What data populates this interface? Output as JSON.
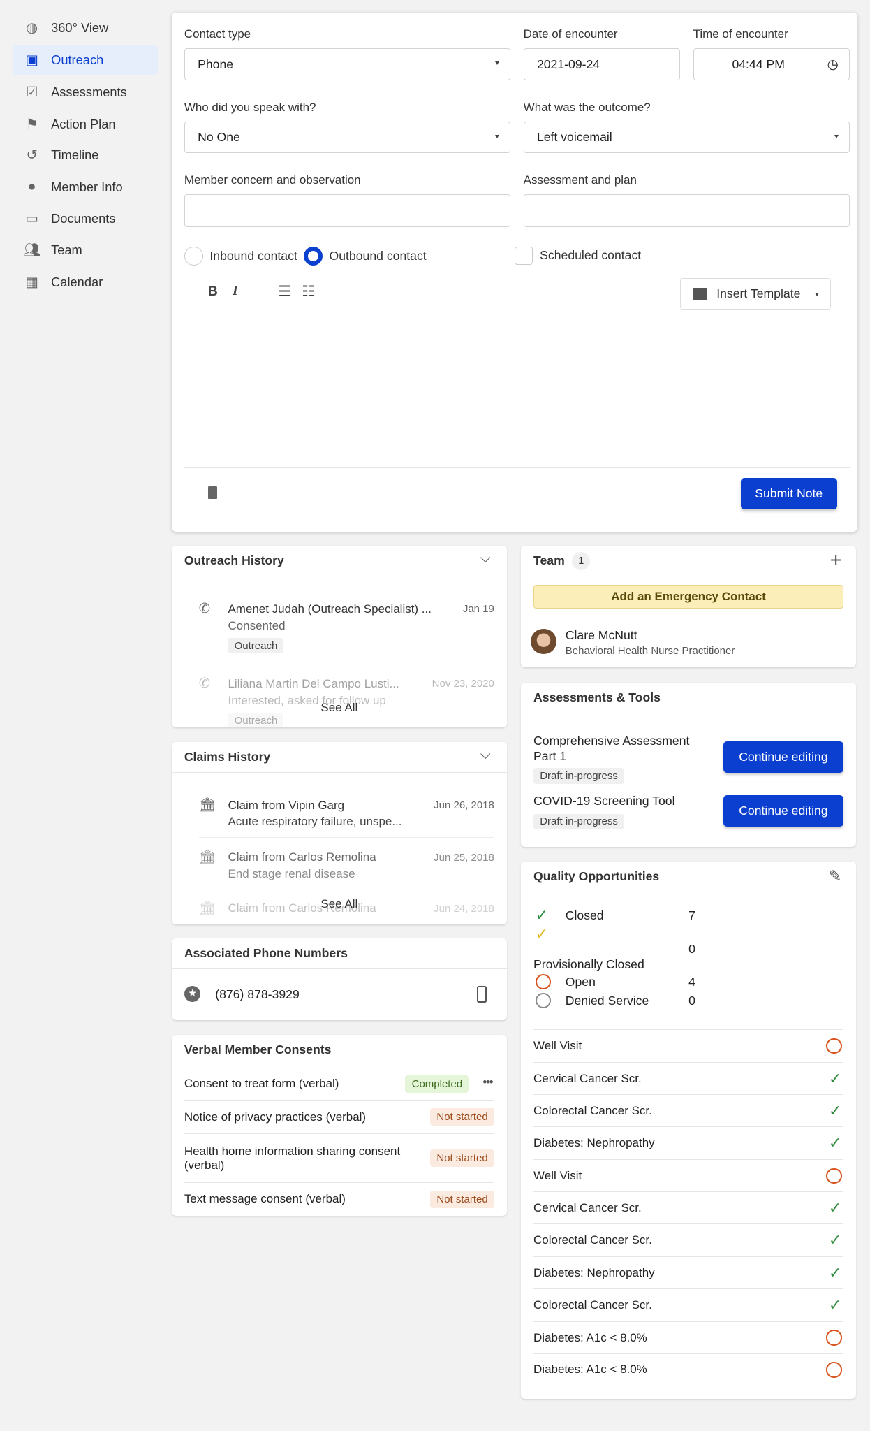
{
  "sidebar": {
    "items": [
      {
        "label": "360° View",
        "icon": "globe-icon"
      },
      {
        "label": "Outreach",
        "icon": "contact-card-icon",
        "active": true
      },
      {
        "label": "Assessments",
        "icon": "clipboard-check-icon"
      },
      {
        "label": "Action Plan",
        "icon": "signpost-icon"
      },
      {
        "label": "Timeline",
        "icon": "history-icon"
      },
      {
        "label": "Member Info",
        "icon": "account-circle-icon"
      },
      {
        "label": "Documents",
        "icon": "folder-icon"
      },
      {
        "label": "Team",
        "icon": "people-icon"
      },
      {
        "label": "Calendar",
        "icon": "calendar-icon"
      }
    ]
  },
  "form": {
    "contact_type_label": "Contact type",
    "contact_type": "Phone",
    "date_label": "Date of encounter",
    "date": "2021-09-24",
    "time_label": "Time of encounter",
    "time": "04:44 PM",
    "who_label": "Who did you speak with?",
    "who": "No One",
    "outcome_label": "What was the outcome?",
    "outcome": "Left voicemail",
    "concern_label": "Member concern and observation",
    "concern": "",
    "plan_label": "Assessment and plan",
    "plan": "",
    "inbound_label": "Inbound contact",
    "outbound_label": "Outbound contact",
    "selected_direction": "outbound",
    "scheduled_label": "Scheduled contact",
    "scheduled": false,
    "insert_template": "Insert Template",
    "submit": "Submit Note"
  },
  "outreach_history": {
    "title": "Outreach History",
    "see_all": "See All",
    "items": [
      {
        "title": "Amenet Judah (Outreach Specialist) ...",
        "date": "Jan 19",
        "status": "Consented",
        "tag": "Outreach"
      },
      {
        "title": "Liliana Martin Del Campo Lusti...",
        "date": "Nov 23, 2020",
        "status": "Interested, asked for follow up",
        "tag": "Outreach"
      }
    ]
  },
  "claims_history": {
    "title": "Claims History",
    "see_all": "See All",
    "items": [
      {
        "title": "Claim from Vipin Garg",
        "date": "Jun 26, 2018",
        "desc": "Acute respiratory failure, unspe..."
      },
      {
        "title": "Claim from Carlos Remolina",
        "date": "Jun 25, 2018",
        "desc": "End stage renal disease"
      },
      {
        "title": "Claim from Carlos Remolina",
        "date": "Jun 24, 2018",
        "desc": ""
      }
    ]
  },
  "phones": {
    "title": "Associated Phone Numbers",
    "number": "(876) 878-3929"
  },
  "consents": {
    "title": "Verbal Member Consents",
    "items": [
      {
        "label": "Consent to treat form (verbal)",
        "status": "Completed"
      },
      {
        "label": "Notice of privacy practices (verbal)",
        "status": "Not started"
      },
      {
        "label": "Health home information sharing consent (verbal)",
        "status": "Not started"
      },
      {
        "label": "Text message consent (verbal)",
        "status": "Not started"
      }
    ]
  },
  "team": {
    "title": "Team",
    "count": "1",
    "emergency": "Add an Emergency Contact",
    "member_name": "Clare McNutt",
    "member_role": "Behavioral Health Nurse Practitioner"
  },
  "assessments": {
    "title": "Assessments & Tools",
    "items": [
      {
        "name": "Comprehensive Assessment Part 1",
        "status": "Draft in-progress",
        "action": "Continue editing"
      },
      {
        "name": "COVID-19 Screening Tool",
        "status": "Draft in-progress",
        "action": "Continue editing"
      }
    ]
  },
  "quality": {
    "title": "Quality Opportunities",
    "summary": [
      {
        "label": "Closed",
        "count": "7"
      },
      {
        "label": "Provisionally Closed",
        "count": "0"
      },
      {
        "label": "Open",
        "count": "4"
      },
      {
        "label": "Denied Service",
        "count": "0"
      }
    ],
    "items": [
      {
        "label": "Well Visit",
        "status": "open"
      },
      {
        "label": "Cervical Cancer Scr.",
        "status": "closed"
      },
      {
        "label": "Colorectal Cancer Scr.",
        "status": "closed"
      },
      {
        "label": "Diabetes: Nephropathy",
        "status": "closed"
      },
      {
        "label": "Well Visit",
        "status": "open"
      },
      {
        "label": "Cervical Cancer Scr.",
        "status": "closed"
      },
      {
        "label": "Colorectal Cancer Scr.",
        "status": "closed"
      },
      {
        "label": "Diabetes: Nephropathy",
        "status": "closed"
      },
      {
        "label": "Colorectal Cancer Scr.",
        "status": "closed"
      },
      {
        "label": "Diabetes: A1c < 8.0%",
        "status": "open"
      },
      {
        "label": "Diabetes: A1c < 8.0%",
        "status": "open"
      }
    ]
  },
  "colors": {
    "accent": "#0b3fcf",
    "open": "#d9531e",
    "closed": "#2e8b3c",
    "provisional": "#e5b720",
    "emergency_bg": "#fbeeb8"
  }
}
